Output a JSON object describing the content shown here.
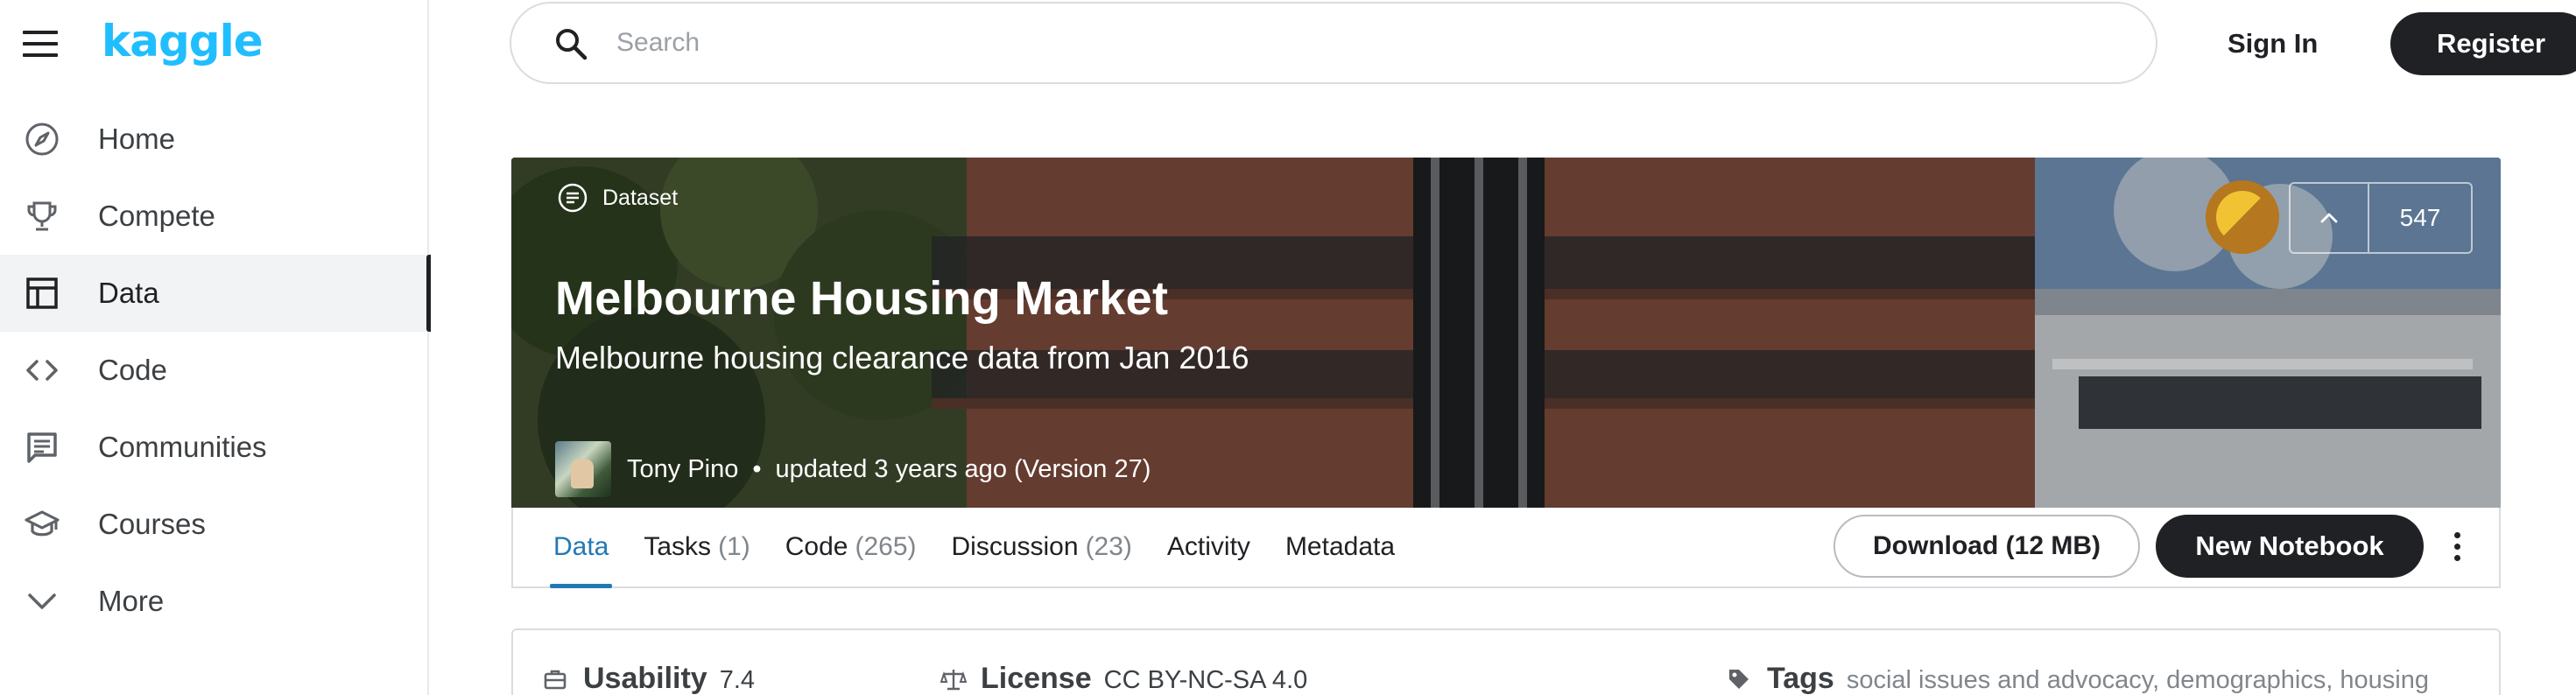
{
  "app": {
    "logo_text": "kaggle",
    "brand_color": "#20beff"
  },
  "sidebar": {
    "items": [
      {
        "label": "Home",
        "icon": "compass-icon"
      },
      {
        "label": "Compete",
        "icon": "trophy-icon"
      },
      {
        "label": "Data",
        "icon": "table-icon",
        "active": true
      },
      {
        "label": "Code",
        "icon": "code-icon"
      },
      {
        "label": "Communities",
        "icon": "comment-icon"
      },
      {
        "label": "Courses",
        "icon": "school-icon"
      },
      {
        "label": "More",
        "icon": "chevron-down-icon"
      }
    ]
  },
  "header": {
    "search_placeholder": "Search",
    "signin_label": "Sign In",
    "register_label": "Register"
  },
  "dataset": {
    "type_label": "Dataset",
    "title": "Melbourne Housing Market",
    "subtitle": "Melbourne housing clearance data from Jan 2016",
    "author": "Tony Pino",
    "separator": "•",
    "updated": "updated 3 years ago (Version 27)",
    "votes": "547",
    "medal_color": "#b5771f"
  },
  "tabs": [
    {
      "label": "Data",
      "count": "",
      "active": true
    },
    {
      "label": "Tasks",
      "count": "(1)"
    },
    {
      "label": "Code",
      "count": "(265)"
    },
    {
      "label": "Discussion",
      "count": "(23)"
    },
    {
      "label": "Activity",
      "count": ""
    },
    {
      "label": "Metadata",
      "count": ""
    }
  ],
  "actions": {
    "download_label": "Download (12 MB)",
    "new_notebook_label": "New Notebook"
  },
  "info": {
    "usability_label": "Usability",
    "usability_value": "7.4",
    "license_label": "License",
    "license_value": "CC BY-NC-SA 4.0",
    "tags_label": "Tags",
    "tags": [
      "social issues and advocacy",
      "demographics",
      "housing"
    ]
  },
  "colors": {
    "accent_tab": "#2079b5",
    "dark_button": "#202124"
  }
}
